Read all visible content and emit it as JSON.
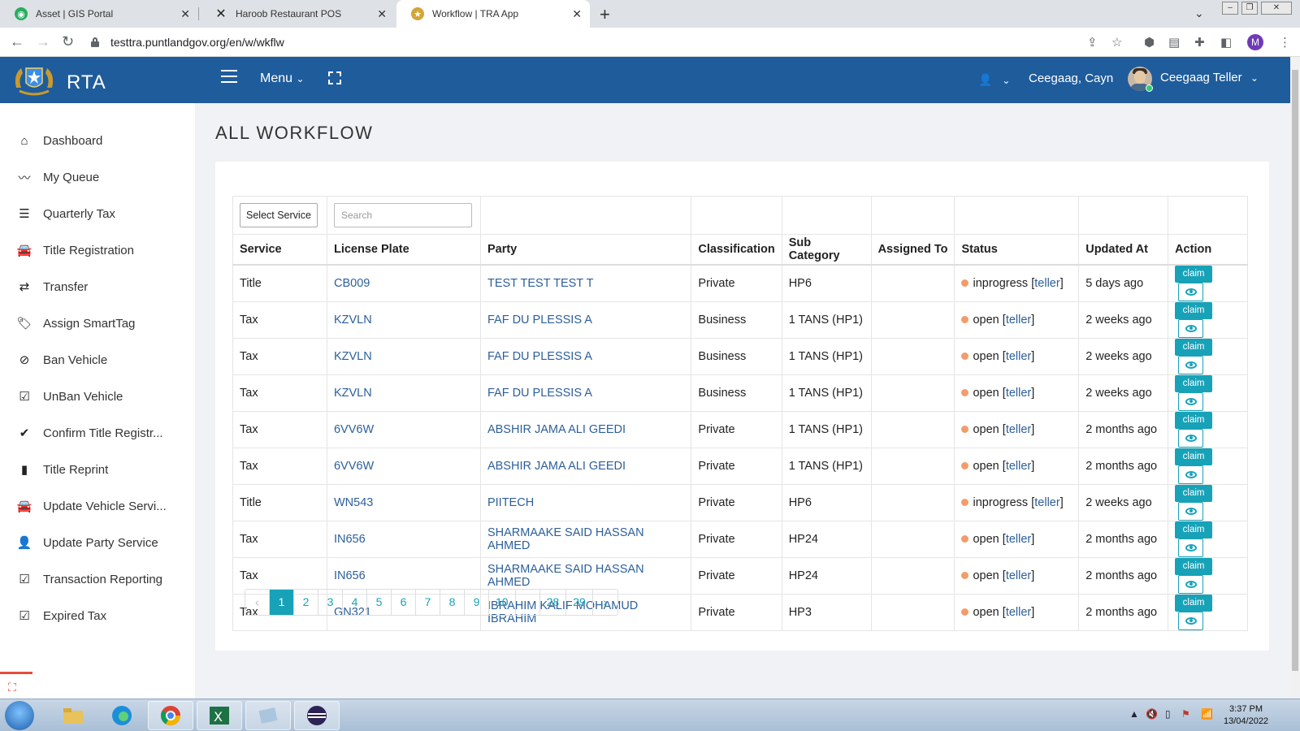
{
  "browser": {
    "tabs": [
      {
        "title": "Asset | GIS Portal",
        "active": false,
        "icon": "gis-icon"
      },
      {
        "title": "Haroob Restaurant POS",
        "active": false,
        "icon": "x-logo-icon"
      },
      {
        "title": "Workflow | TRA App",
        "active": true,
        "icon": "emblem-icon"
      }
    ],
    "url": "testtra.puntlandgov.org/en/w/wkflw",
    "profile_initial": "M"
  },
  "header": {
    "brand": "RTA",
    "menu_label": "Menu",
    "user_name": "Ceegaag, Cayn",
    "user_role": "Ceegaag Teller",
    "color": "#1f5c9b"
  },
  "sidebar": {
    "items": [
      {
        "label": "Dashboard",
        "icon": "home-icon"
      },
      {
        "label": "My Queue",
        "icon": "trend-icon"
      },
      {
        "label": "Quarterly Tax",
        "icon": "list-icon"
      },
      {
        "label": "Title Registration",
        "icon": "car-icon"
      },
      {
        "label": "Transfer",
        "icon": "exchange-icon"
      },
      {
        "label": "Assign SmartTag",
        "icon": "tags-icon"
      },
      {
        "label": "Ban Vehicle",
        "icon": "ban-icon"
      },
      {
        "label": "UnBan Vehicle",
        "icon": "check-square-icon"
      },
      {
        "label": "Confirm Title Registr...",
        "icon": "check-icon"
      },
      {
        "label": "Title Reprint",
        "icon": "file-icon"
      },
      {
        "label": "Update Vehicle Servi...",
        "icon": "car-icon"
      },
      {
        "label": "Update Party Service",
        "icon": "user-icon"
      },
      {
        "label": "Transaction Reporting",
        "icon": "check-square-icon"
      },
      {
        "label": "Expired Tax",
        "icon": "check-square-icon"
      }
    ]
  },
  "main": {
    "title": "ALL WORKFLOW",
    "filters": {
      "service_select": "Select Service",
      "search_placeholder": "Search"
    },
    "columns": [
      "Service",
      "License Plate",
      "Party",
      "Classification",
      "Sub Category",
      "Assigned To",
      "Status",
      "Updated At",
      "Action"
    ],
    "rows": [
      {
        "service": "Title",
        "plate": "CB009",
        "party": "TEST TEST TEST T",
        "classification": "Private",
        "sub": "HP6",
        "assigned": "",
        "status": "inprogress",
        "role": "teller",
        "updated": "5 days ago"
      },
      {
        "service": "Tax",
        "plate": "KZVLN",
        "party": "FAF DU PLESSIS A",
        "classification": "Business",
        "sub": "1 TANS (HP1)",
        "assigned": "",
        "status": "open",
        "role": "teller",
        "updated": "2 weeks ago"
      },
      {
        "service": "Tax",
        "plate": "KZVLN",
        "party": "FAF DU PLESSIS A",
        "classification": "Business",
        "sub": "1 TANS (HP1)",
        "assigned": "",
        "status": "open",
        "role": "teller",
        "updated": "2 weeks ago"
      },
      {
        "service": "Tax",
        "plate": "KZVLN",
        "party": "FAF DU PLESSIS A",
        "classification": "Business",
        "sub": "1 TANS (HP1)",
        "assigned": "",
        "status": "open",
        "role": "teller",
        "updated": "2 weeks ago"
      },
      {
        "service": "Tax",
        "plate": "6VV6W",
        "party": "ABSHIR JAMA ALI GEEDI",
        "classification": "Private",
        "sub": "1 TANS (HP1)",
        "assigned": "",
        "status": "open",
        "role": "teller",
        "updated": "2 months ago"
      },
      {
        "service": "Tax",
        "plate": "6VV6W",
        "party": "ABSHIR JAMA ALI GEEDI",
        "classification": "Private",
        "sub": "1 TANS (HP1)",
        "assigned": "",
        "status": "open",
        "role": "teller",
        "updated": "2 months ago"
      },
      {
        "service": "Title",
        "plate": "WN543",
        "party": "PIITECH",
        "classification": "Private",
        "sub": "HP6",
        "assigned": "",
        "status": "inprogress",
        "role": "teller",
        "updated": "2 weeks ago"
      },
      {
        "service": "Tax",
        "plate": "IN656",
        "party": "SHARMAAKE SAID HASSAN AHMED",
        "classification": "Private",
        "sub": "HP24",
        "assigned": "",
        "status": "open",
        "role": "teller",
        "updated": "2 months ago"
      },
      {
        "service": "Tax",
        "plate": "IN656",
        "party": "SHARMAAKE SAID HASSAN AHMED",
        "classification": "Private",
        "sub": "HP24",
        "assigned": "",
        "status": "open",
        "role": "teller",
        "updated": "2 months ago"
      },
      {
        "service": "Tax",
        "plate": "GN321",
        "party": "IBRAHIM KALIF MOHAMUD IBRAHIM",
        "classification": "Private",
        "sub": "HP3",
        "assigned": "",
        "status": "open",
        "role": "teller",
        "updated": "2 months ago"
      }
    ],
    "claim_label": "claim",
    "status_dot_color": "#f39c6b",
    "accent": "#17a2b8",
    "pagination": {
      "prev": "‹",
      "pages": [
        "1",
        "2",
        "3",
        "4",
        "5",
        "6",
        "7",
        "8",
        "9",
        "10",
        "...",
        "28",
        "29"
      ],
      "next": "›",
      "current": "1"
    }
  },
  "taskbar": {
    "time": "3:37 PM",
    "date": "13/04/2022"
  }
}
